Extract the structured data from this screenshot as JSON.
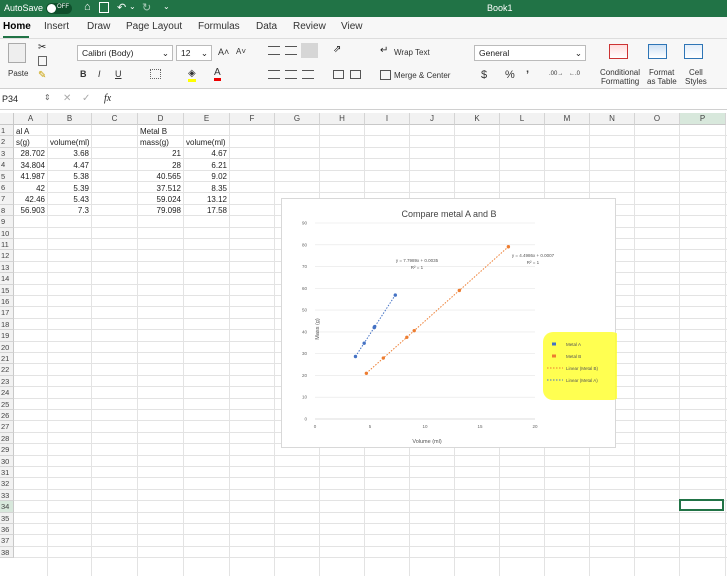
{
  "titlebar": {
    "autosave": "AutoSave",
    "autosave_state": "OFF",
    "book": "Book1"
  },
  "tabs": [
    "Home",
    "Insert",
    "Draw",
    "Page Layout",
    "Formulas",
    "Data",
    "Review",
    "View"
  ],
  "ribbon": {
    "paste": "Paste",
    "font_name": "Calibri (Body)",
    "font_size": "12",
    "wrap_text": "Wrap Text",
    "merge_center": "Merge & Center",
    "number_format": "General",
    "conditional": "Conditional",
    "formatting": "Formatting",
    "format": "Format",
    "as_table": "as Table",
    "cell": "Cell",
    "styles": "Styles",
    "bold": "B",
    "italic": "I",
    "underline": "U",
    "grow_font": "A˄",
    "shrink_font": "A˅",
    "currency": "$",
    "percent": "%",
    "comma": "’",
    "inc_decimal": ".00→",
    "dec_decimal": "←.0"
  },
  "formula_bar": {
    "name_box": "P34",
    "fx": "fx",
    "value": ""
  },
  "columns": [
    "A",
    "B",
    "C",
    "D",
    "E",
    "F",
    "G",
    "H",
    "I",
    "J",
    "K",
    "L",
    "M",
    "N",
    "O",
    "P"
  ],
  "rows": [
    "1",
    "2",
    "3",
    "4",
    "5",
    "6",
    "7",
    "8",
    "9",
    "10",
    "11",
    "12",
    "13",
    "14",
    "15",
    "16",
    "17",
    "18",
    "19",
    "20",
    "21",
    "22",
    "23",
    "24",
    "25",
    "26",
    "27",
    "28",
    "29",
    "30",
    "31",
    "32",
    "33",
    "34",
    "35",
    "36",
    "37",
    "38"
  ],
  "cells": {
    "A1": "al A",
    "D1": "Metal B",
    "A2": "s(g)",
    "B2": "volume(ml)",
    "D2": "mass(g)",
    "E2": "volume(ml)",
    "A3": "28.702",
    "B3": "3.68",
    "D3": "21",
    "E3": "4.67",
    "A4": "34.804",
    "B4": "4.47",
    "D4": "28",
    "E4": "6.21",
    "A5": "41.987",
    "B5": "5.38",
    "D5": "40.565",
    "E5": "9.02",
    "A6": "42",
    "B6": "5.39",
    "D6": "37.512",
    "E6": "8.35",
    "A7": "42.46",
    "B7": "5.43",
    "D7": "59.024",
    "E7": "13.12",
    "A8": "56.903",
    "B8": "7.3",
    "D8": "79.098",
    "E8": "17.58"
  },
  "chart_data": {
    "type": "scatter",
    "title": "Compare metal A and B",
    "xlabel": "Volume (ml)",
    "ylabel": "Mass (g)",
    "xlim": [
      0,
      20
    ],
    "ylim": [
      0,
      90
    ],
    "xticks": [
      "0",
      "5",
      "10",
      "15",
      "20"
    ],
    "yticks": [
      "0",
      "10",
      "20",
      "30",
      "40",
      "50",
      "60",
      "70",
      "80",
      "90"
    ],
    "series": [
      {
        "name": "Metal A",
        "color": "#4472c4",
        "x": [
          3.68,
          4.47,
          5.38,
          5.39,
          5.43,
          7.3
        ],
        "y": [
          28.702,
          34.804,
          41.987,
          42,
          42.46,
          56.903
        ]
      },
      {
        "name": "Metal B",
        "color": "#ed7d31",
        "x": [
          4.67,
          6.21,
          9.02,
          8.35,
          13.12,
          17.58
        ],
        "y": [
          21,
          28,
          40.565,
          37.512,
          59.024,
          79.098
        ]
      }
    ],
    "trendlines": [
      {
        "name": "Linear (Metal B)",
        "color": "#ed7d31",
        "slope": 4.4986,
        "intercept": 0.0007,
        "x_range": [
          4.67,
          17.58
        ]
      },
      {
        "name": "Linear (Metal A)",
        "color": "#4472c4",
        "slope": 7.7989,
        "intercept": 0.0035,
        "x_range": [
          3.68,
          7.3
        ]
      }
    ],
    "equations": [
      {
        "eq": "y = 7.7989x + 0.0035",
        "r2": "R² = 1"
      },
      {
        "eq": "y = 4.4986x + 0.0007",
        "r2": "R² = 1"
      }
    ],
    "legend_highlight": "#ffff33",
    "legend_position": "right"
  }
}
